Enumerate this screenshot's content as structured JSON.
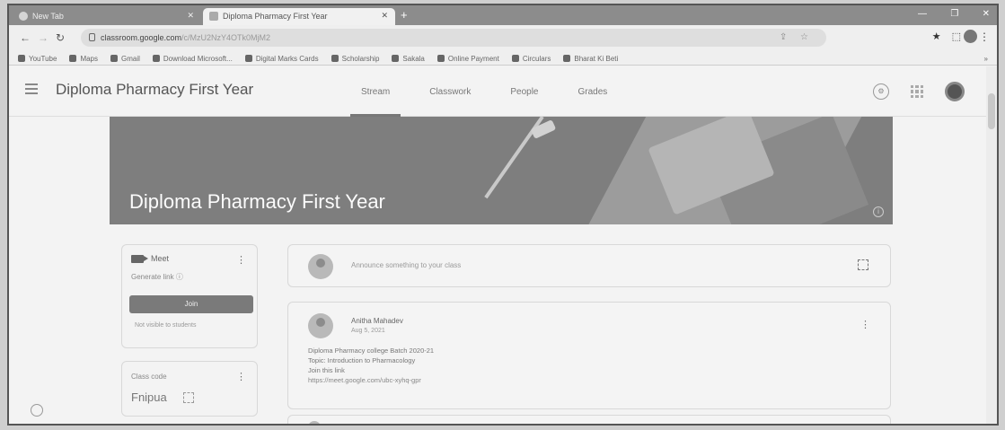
{
  "browser": {
    "tabs": [
      {
        "title": "New Tab"
      },
      {
        "title": "Diploma Pharmacy First Year"
      }
    ],
    "address_host": "classroom.google.com",
    "address_path": "/c/MzU2NzY4OTk0MjM2"
  },
  "bookmarks": [
    {
      "label": "YouTube"
    },
    {
      "label": "Maps"
    },
    {
      "label": "Gmail"
    },
    {
      "label": "Download Microsoft..."
    },
    {
      "label": "Digital Marks Cards"
    },
    {
      "label": "Scholarship"
    },
    {
      "label": "Sakala"
    },
    {
      "label": "Online Payment"
    },
    {
      "label": "Circulars"
    },
    {
      "label": "Bharat Ki Beti"
    }
  ],
  "app": {
    "class_title": "Diploma Pharmacy First Year",
    "nav_tabs": [
      "Stream",
      "Classwork",
      "People",
      "Grades"
    ],
    "active_tab": "Stream"
  },
  "banner": {
    "title": "Diploma Pharmacy First Year"
  },
  "meet": {
    "label": "Meet",
    "link_label": "Generate link",
    "join_label": "Join",
    "note": "Not visible to students"
  },
  "class_code": {
    "label": "Class code",
    "value": "Fnipua"
  },
  "stream": {
    "announce_placeholder": "Announce something to your class",
    "post": {
      "author": "Anitha Mahadev",
      "date": "Aug 5, 2021",
      "lines": [
        "Diploma Pharmacy college Batch 2020-21",
        "Topic: Introduction to Pharmacology",
        "Join this link",
        "https://meet.google.com/ubc-xyhq-gpr"
      ]
    }
  }
}
